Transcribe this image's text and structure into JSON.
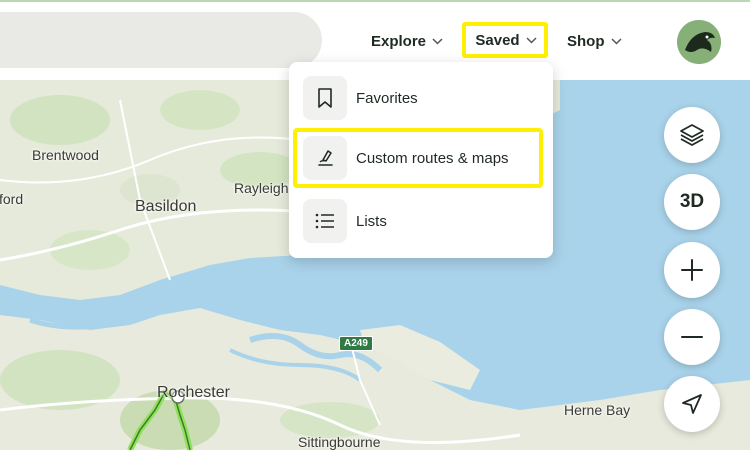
{
  "header": {
    "nav": [
      {
        "label": "Explore"
      },
      {
        "label": "Saved"
      },
      {
        "label": "Shop"
      }
    ]
  },
  "dropdown": {
    "items": [
      {
        "label": "Favorites",
        "icon": "bookmark-icon"
      },
      {
        "label": "Custom routes & maps",
        "icon": "route-pen-icon"
      },
      {
        "label": "Lists",
        "icon": "list-icon"
      }
    ]
  },
  "map": {
    "labels": {
      "brentwood": "Brentwood",
      "ford": "ford",
      "basildon": "Basildon",
      "rayleigh": "Rayleigh",
      "rochester": "Rochester",
      "herne_bay": "Herne Bay",
      "sittingbourne": "Sittingbourne"
    },
    "road_badge": "A249"
  },
  "controls": {
    "layers_icon": "layers-icon",
    "three_d_label": "3D",
    "zoom_in_icon": "plus-icon",
    "zoom_out_icon": "minus-icon",
    "locate_icon": "navigation-arrow-icon"
  },
  "colors": {
    "highlight": "#ffef00",
    "land": "#e8ebde",
    "water": "#a9d3ea",
    "route": "#8fe05a"
  }
}
